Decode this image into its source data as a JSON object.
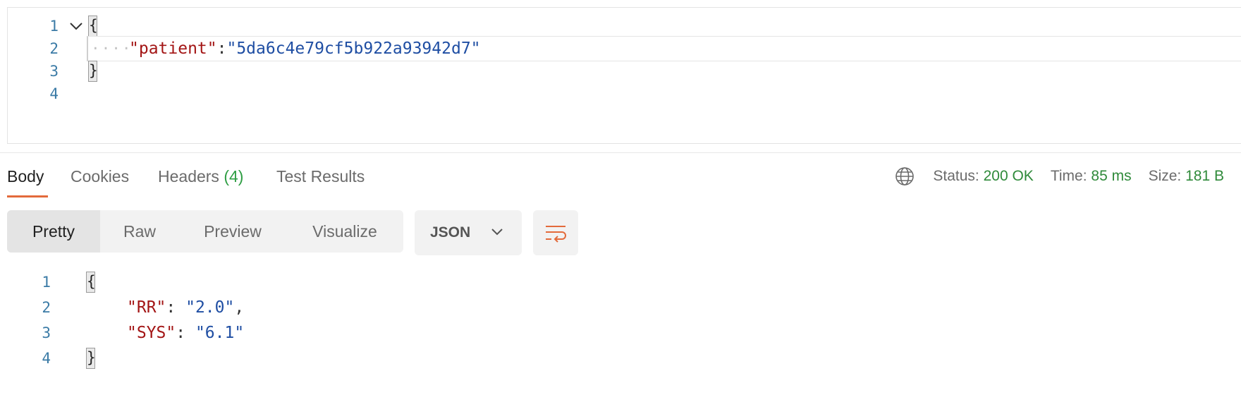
{
  "request_editor": {
    "lines": [
      {
        "num": "1",
        "text": "{"
      },
      {
        "num": "2",
        "indent": "····",
        "key": "\"patient\"",
        "colon": ":",
        "value": "\"5da6c4e79cf5b922a93942d7\""
      },
      {
        "num": "3",
        "text": "}"
      },
      {
        "num": "4",
        "text": ""
      }
    ]
  },
  "response_tabs": {
    "body": "Body",
    "cookies": "Cookies",
    "headers": "Headers",
    "headers_count": "(4)",
    "test_results": "Test Results"
  },
  "status_bar": {
    "status_label": "Status:",
    "status_value": "200 OK",
    "time_label": "Time:",
    "time_value": "85 ms",
    "size_label": "Size:",
    "size_value": "181 B"
  },
  "view_modes": {
    "pretty": "Pretty",
    "raw": "Raw",
    "preview": "Preview",
    "visualize": "Visualize",
    "selected": "Pretty"
  },
  "format_select": {
    "value": "JSON"
  },
  "response_body": {
    "lines": [
      {
        "num": "1",
        "text": "{"
      },
      {
        "num": "2",
        "key": "\"RR\"",
        "colon": ": ",
        "value": "\"2.0\"",
        "trail": ","
      },
      {
        "num": "3",
        "key": "\"SYS\"",
        "colon": ": ",
        "value": "\"6.1\"",
        "trail": ""
      },
      {
        "num": "4",
        "text": "}"
      }
    ]
  },
  "colors": {
    "accent": "#e36a3b",
    "success": "#2f8a3a",
    "json_key": "#a31515",
    "json_string": "#1f4ea3",
    "line_number": "#3b7ba6"
  },
  "icons": {
    "fold": "chevron-down-icon",
    "globe": "globe-icon",
    "select_chevron": "chevron-down-icon",
    "wrap": "word-wrap-icon"
  }
}
